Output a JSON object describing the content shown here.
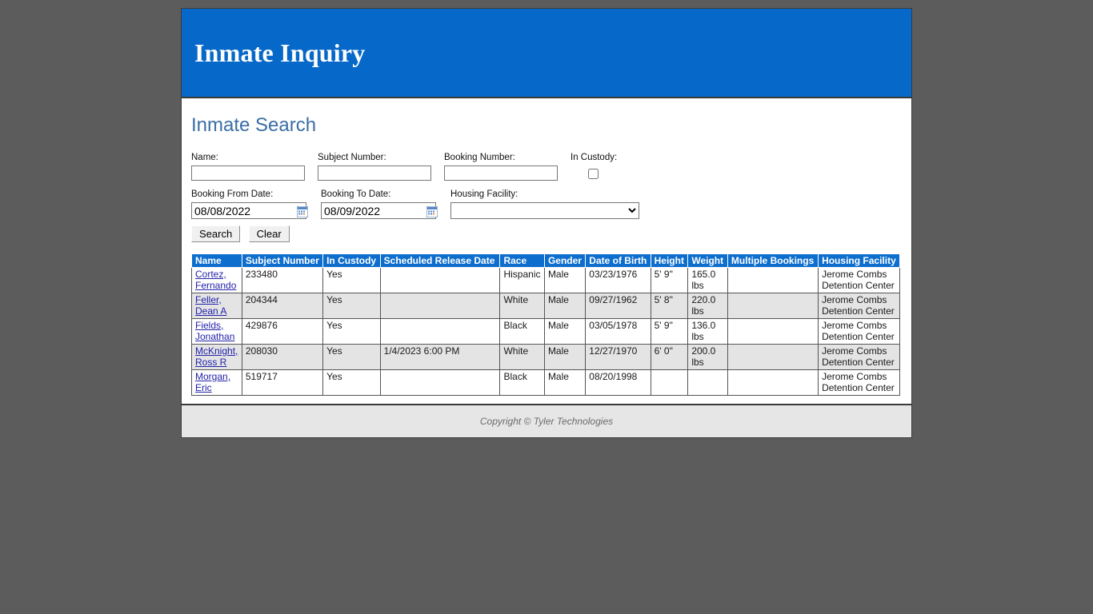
{
  "header": {
    "title": "Inmate Inquiry"
  },
  "section": {
    "title": "Inmate Search"
  },
  "search_form": {
    "name": {
      "label": "Name:",
      "value": "",
      "placeholder": ""
    },
    "subject_number": {
      "label": "Subject Number:",
      "value": "",
      "placeholder": ""
    },
    "booking_number": {
      "label": "Booking Number:",
      "value": "",
      "placeholder": ""
    },
    "in_custody": {
      "label": "In Custody:",
      "checked": false
    },
    "booking_from_date": {
      "label": "Booking From Date:",
      "value": "08/08/2022"
    },
    "booking_to_date": {
      "label": "Booking To Date:",
      "value": "08/09/2022"
    },
    "housing_facility": {
      "label": "Housing Facility:",
      "value": "",
      "options": [
        ""
      ]
    },
    "search_button": "Search",
    "clear_button": "Clear"
  },
  "results_table": {
    "columns": [
      "Name",
      "Subject Number",
      "In Custody",
      "Scheduled Release Date",
      "Race",
      "Gender",
      "Date of Birth",
      "Height",
      "Weight",
      "Multiple Bookings",
      "Housing Facility"
    ],
    "rows": [
      {
        "name": "Cortez, Fernando",
        "subject_number": "233480",
        "in_custody": "Yes",
        "scheduled_release_date": "",
        "race": "Hispanic",
        "gender": "Male",
        "date_of_birth": "03/23/1976",
        "height": "5' 9\"",
        "weight": "165.0 lbs",
        "multiple_bookings": "",
        "housing_facility": "Jerome Combs Detention Center"
      },
      {
        "name": "Feller, Dean A",
        "subject_number": "204344",
        "in_custody": "Yes",
        "scheduled_release_date": "",
        "race": "White",
        "gender": "Male",
        "date_of_birth": "09/27/1962",
        "height": "5' 8\"",
        "weight": "220.0 lbs",
        "multiple_bookings": "",
        "housing_facility": "Jerome Combs Detention Center"
      },
      {
        "name": "Fields, Jonathan",
        "subject_number": "429876",
        "in_custody": "Yes",
        "scheduled_release_date": "",
        "race": "Black",
        "gender": "Male",
        "date_of_birth": "03/05/1978",
        "height": "5' 9\"",
        "weight": "136.0 lbs",
        "multiple_bookings": "",
        "housing_facility": "Jerome Combs Detention Center"
      },
      {
        "name": "McKnight, Ross R",
        "subject_number": "208030",
        "in_custody": "Yes",
        "scheduled_release_date": "1/4/2023 6:00 PM",
        "race": "White",
        "gender": "Male",
        "date_of_birth": "12/27/1970",
        "height": "6' 0\"",
        "weight": "200.0 lbs",
        "multiple_bookings": "",
        "housing_facility": "Jerome Combs Detention Center"
      },
      {
        "name": "Morgan, Eric",
        "subject_number": "519717",
        "in_custody": "Yes",
        "scheduled_release_date": "",
        "race": "Black",
        "gender": "Male",
        "date_of_birth": "08/20/1998",
        "height": "",
        "weight": "",
        "multiple_bookings": "",
        "housing_facility": "Jerome Combs Detention Center"
      }
    ]
  },
  "footer": {
    "copyright": "Copyright © Tyler Technologies"
  },
  "colors": {
    "header_blue": "#0668c8",
    "table_header_blue": "#0d6ecd",
    "section_title_blue": "#3a6ea5",
    "link_blue": "#2222aa",
    "page_background": "#5c5c5c",
    "alt_row": "#e4e4e4",
    "footer_background": "#e6e6e6"
  }
}
